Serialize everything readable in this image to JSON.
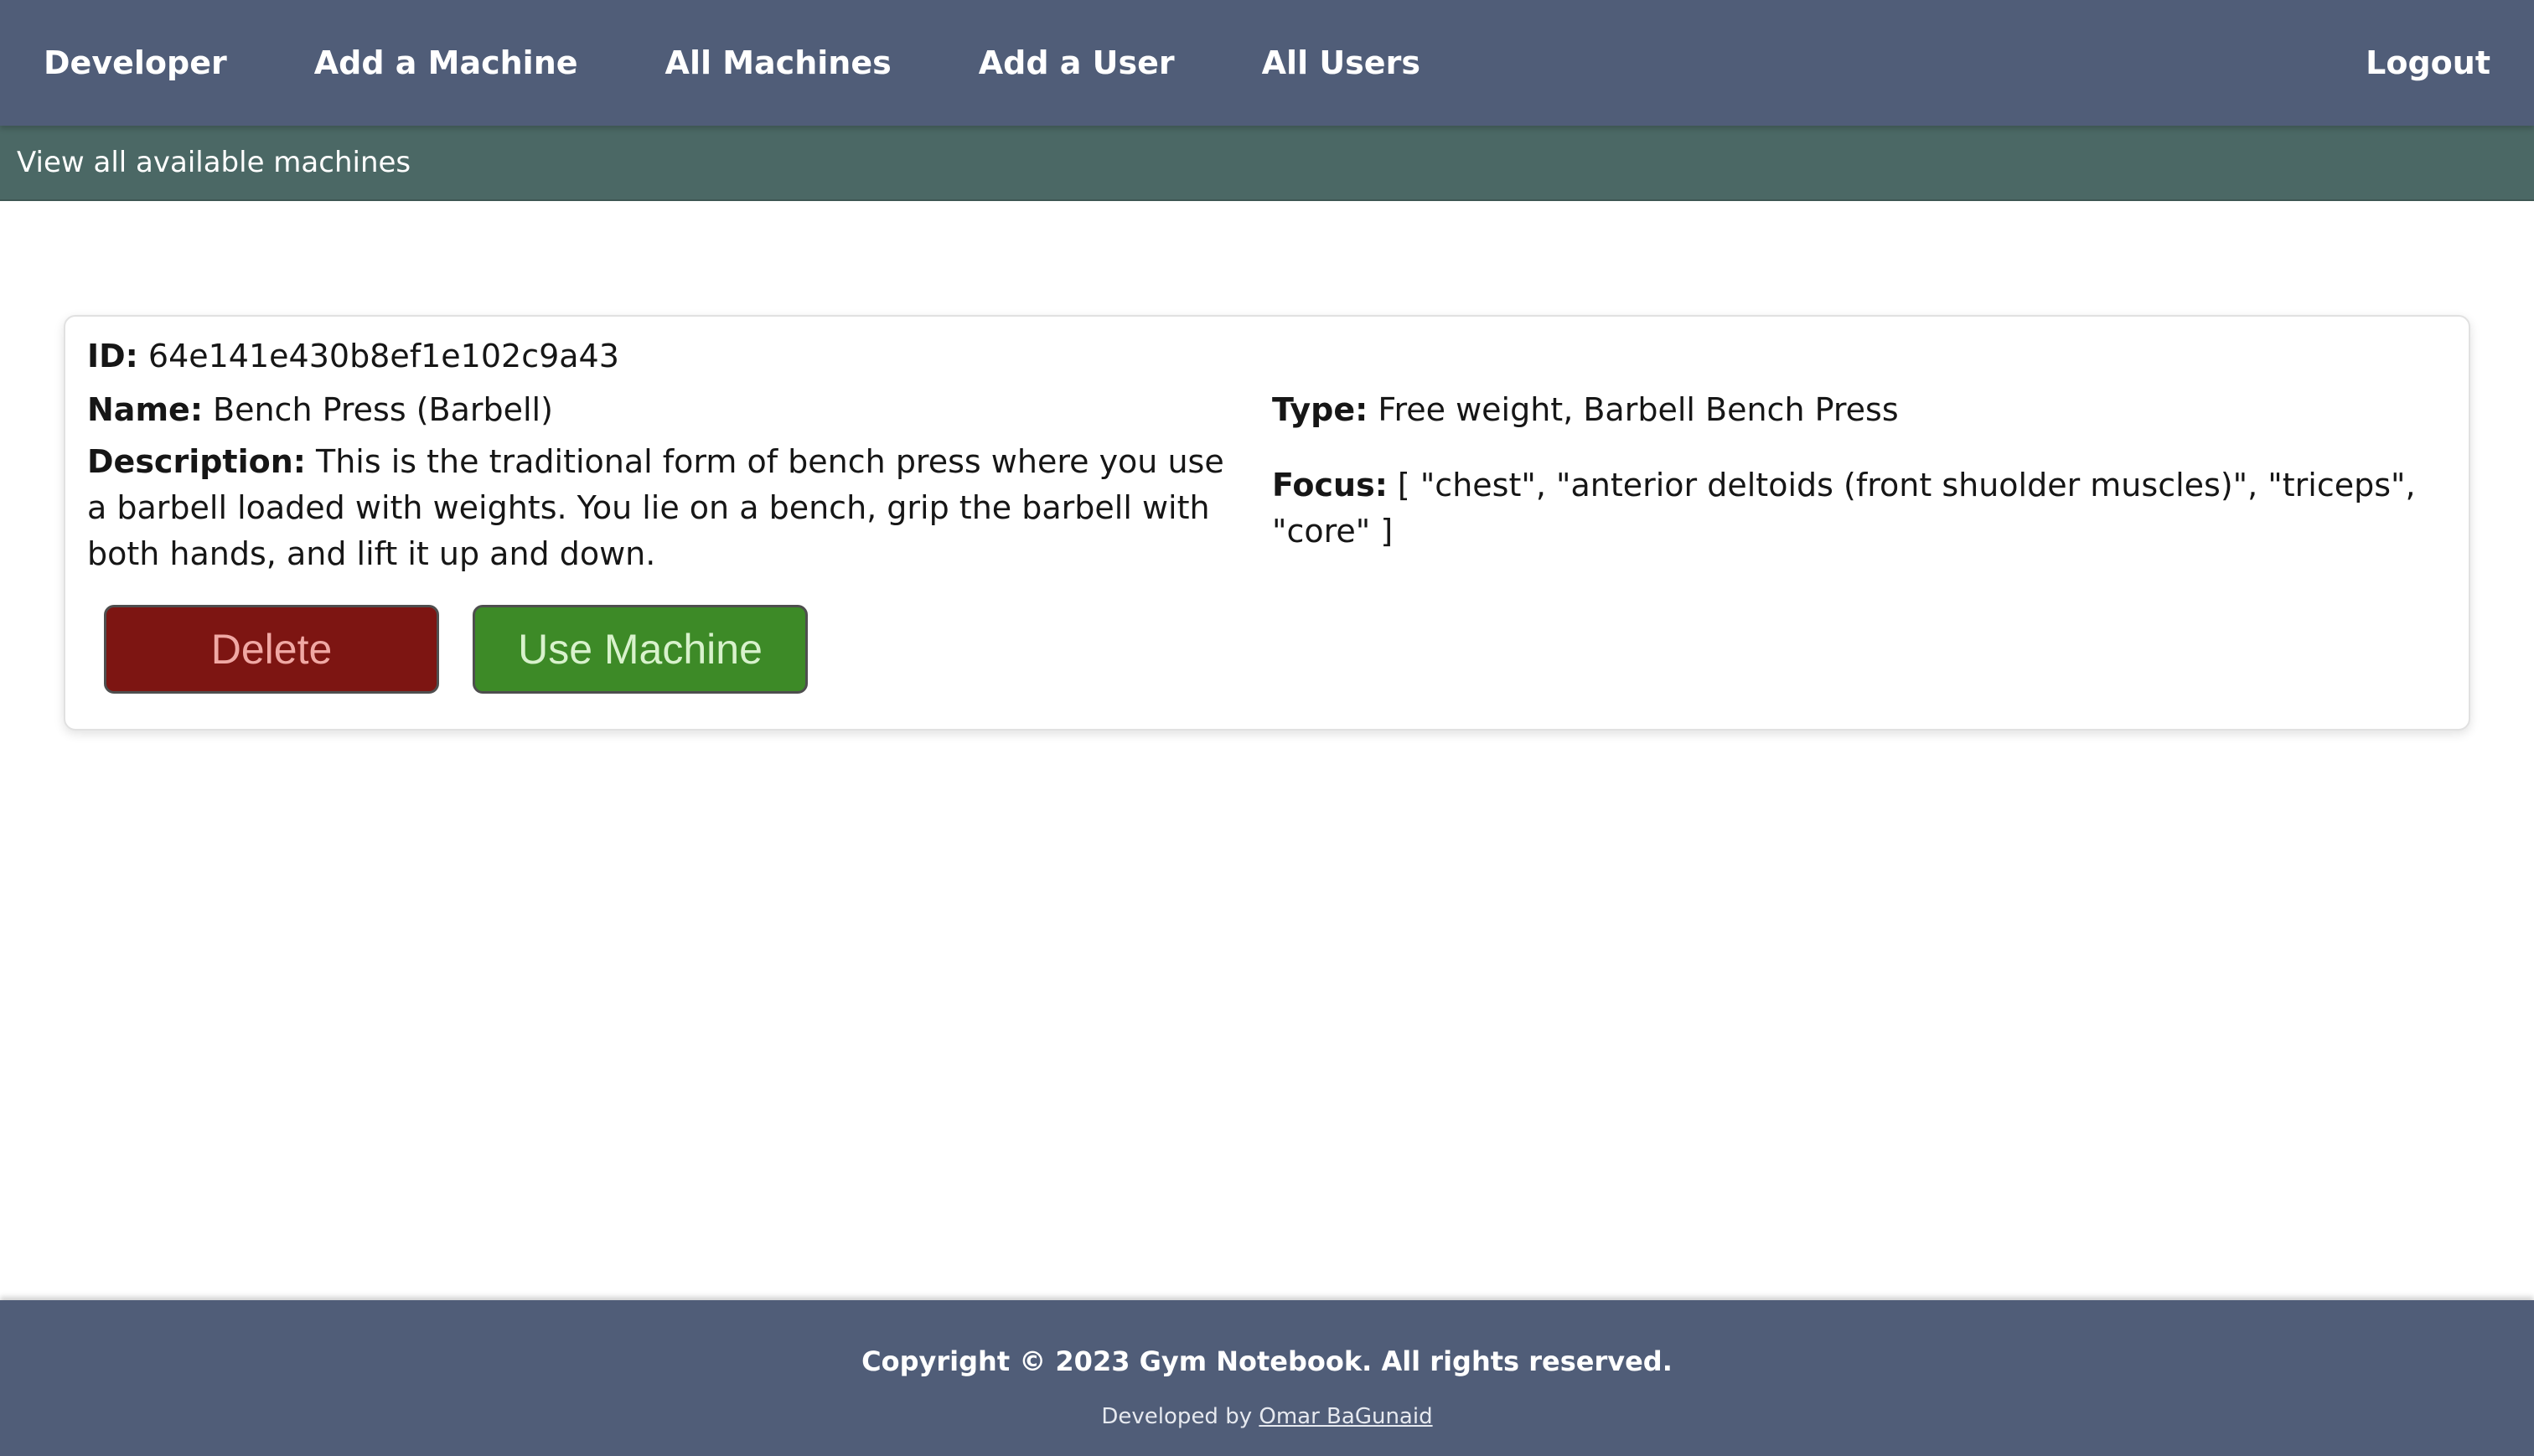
{
  "nav": {
    "items": [
      {
        "label": "Developer"
      },
      {
        "label": "Add a Machine"
      },
      {
        "label": "All Machines"
      },
      {
        "label": "Add a User"
      },
      {
        "label": "All Users"
      }
    ],
    "logout_label": "Logout"
  },
  "subbar": {
    "text": "View all available machines"
  },
  "machine": {
    "id_label": "ID:",
    "id_value": "64e141e430b8ef1e102c9a43",
    "name_label": "Name:",
    "name_value": "Bench Press (Barbell)",
    "description_label": "Description:",
    "description_value": "This is the traditional form of bench press where you use a barbell loaded with weights. You lie on a bench, grip the barbell with both hands, and lift it up and down.",
    "type_label": "Type:",
    "type_value": "Free weight, Barbell Bench Press",
    "focus_label": "Focus:",
    "focus_value": "[ \"chest\", \"anterior deltoids (front shuolder muscles)\", \"triceps\", \"core\" ]",
    "delete_label": "Delete",
    "use_label": "Use Machine"
  },
  "footer": {
    "copyright": "Copyright © 2023 Gym Notebook. All rights reserved.",
    "developed_by": "Developed by",
    "developer_name": "Omar BaGunaid"
  },
  "colors": {
    "nav_bg": "#505d78",
    "subbar_bg": "#4b6865",
    "delete_bg": "#7d1512",
    "use_bg": "#3d8a27"
  }
}
